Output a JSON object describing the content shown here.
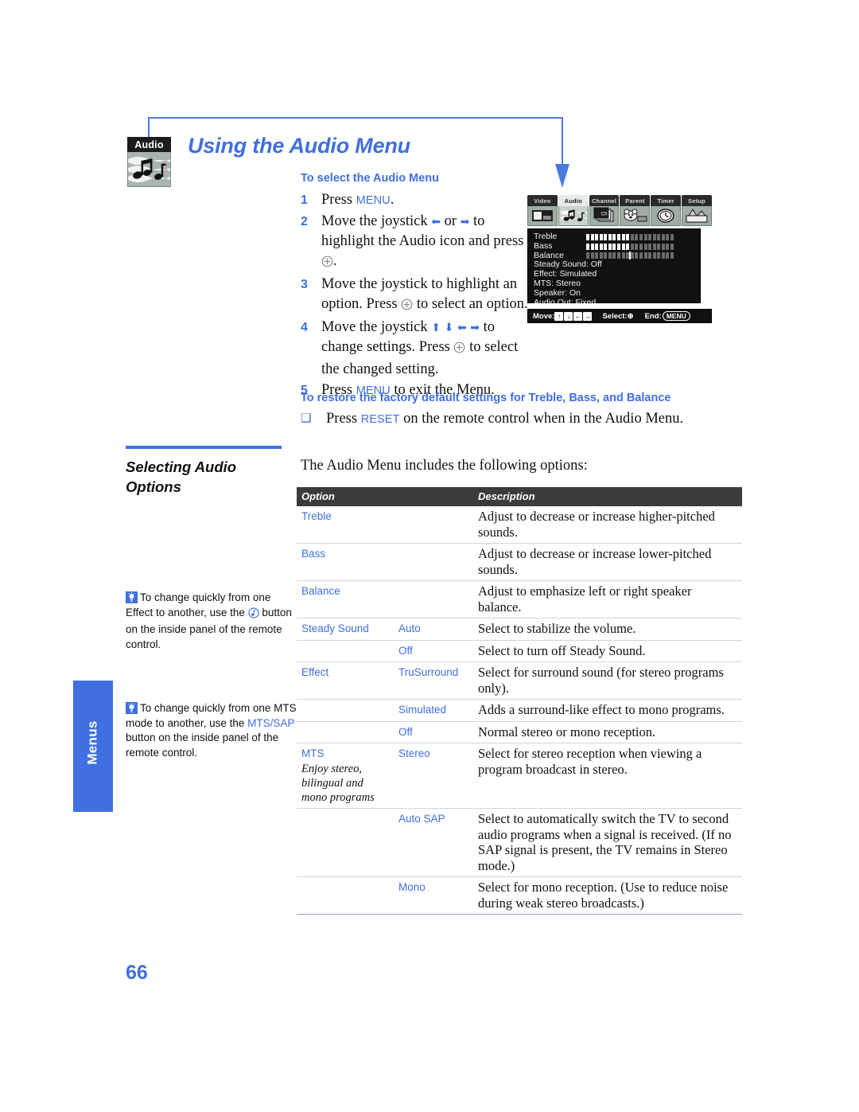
{
  "header": {
    "title": "Using the Audio Menu",
    "icon_label": "Audio",
    "icon_name": "audio-menu-icon"
  },
  "select_section": {
    "heading": "To select the Audio Menu",
    "steps": [
      {
        "num": "1",
        "prefix": "Press ",
        "kw": "MENU",
        "suffix": "."
      },
      {
        "num": "2",
        "prefix": "Move the joystick ",
        "suffix": " to highlight the Audio icon and press "
      },
      {
        "num": "3",
        "prefix": "Move the joystick to highlight an option. Press ",
        "suffix": " to select an option."
      },
      {
        "num": "4",
        "prefix": "Move the joystick ",
        "suffix": " to change settings. Press "
      },
      {
        "num": "5",
        "prefix": "Press ",
        "kw": "MENU",
        "suffix": " to exit the Menu."
      }
    ],
    "step2_tail": ".",
    "step4_tail": " to select the changed setting."
  },
  "tv_menu": {
    "tabs": [
      {
        "label": "Video",
        "icon": "video-icon",
        "selected": false
      },
      {
        "label": "Audio",
        "icon": "audio-notes-icon",
        "selected": true
      },
      {
        "label": "Channel",
        "icon": "channel-icon",
        "selected": false
      },
      {
        "label": "Parent",
        "icon": "parent-bear-icon",
        "selected": false
      },
      {
        "label": "Timer",
        "icon": "clock-icon",
        "selected": false
      },
      {
        "label": "Setup",
        "icon": "setup-icon",
        "selected": false
      }
    ],
    "rows": [
      {
        "name": "Treble",
        "type": "bar",
        "value": 50
      },
      {
        "name": "Bass",
        "type": "bar",
        "value": 50
      },
      {
        "name": "Balance",
        "type": "knob",
        "value": 50
      },
      {
        "name": "Steady Sound: Off",
        "type": "text"
      },
      {
        "name": "Effect: Simulated",
        "type": "text"
      },
      {
        "name": "MTS: Stereo",
        "type": "text"
      },
      {
        "name": "Speaker: On",
        "type": "text"
      },
      {
        "name": "Audio Out: Fixed",
        "type": "text"
      }
    ],
    "footer": {
      "move_label": "Move:",
      "keys": [
        "↑",
        "↓",
        "←",
        "→"
      ],
      "select_label": "Select:",
      "select_symbol": "⊕",
      "end_label": "End:",
      "end_button": "MENU"
    }
  },
  "restore_section": {
    "heading": "To restore the factory default settings for Treble, Bass, and Balance",
    "bullet": "❑",
    "prefix": "Press ",
    "kw": "RESET",
    "suffix": " on the remote control when in the Audio Menu."
  },
  "options_section": {
    "section_title": "Selecting Audio Options",
    "intro": "The Audio Menu includes the following options:",
    "columns": [
      "Option",
      "Description"
    ],
    "rows": [
      {
        "option": "Treble",
        "value": "",
        "desc": "Adjust to decrease or increase higher-pitched sounds."
      },
      {
        "option": "Bass",
        "value": "",
        "desc": "Adjust to decrease or increase lower-pitched sounds."
      },
      {
        "option": "Balance",
        "value": "",
        "desc": "Adjust to emphasize left or right speaker balance."
      },
      {
        "option": "Steady Sound",
        "value": "Auto",
        "desc": "Select to stabilize the volume."
      },
      {
        "option": "",
        "value": "Off",
        "desc": "Select to turn off Steady Sound."
      },
      {
        "option": "Effect",
        "value": "TruSurround",
        "desc": "Select for surround sound (for stereo programs only)."
      },
      {
        "option": "",
        "value": "Simulated",
        "desc": "Adds a surround-like effect to mono programs."
      },
      {
        "option": "",
        "value": "Off",
        "desc": "Normal stereo or mono reception."
      },
      {
        "option": "MTS",
        "option_sub": "Enjoy stereo, bilingual and mono programs",
        "value": "Stereo",
        "desc": "Select for stereo reception when viewing a program broadcast in stereo."
      },
      {
        "option": "",
        "value": "Auto SAP",
        "desc": "Select to automatically switch the TV to second audio programs when a signal is received. (If no SAP signal is present, the TV remains in Stereo mode.)"
      },
      {
        "option": "",
        "value": "Mono",
        "desc": "Select for mono reception. (Use to reduce noise during weak stereo broadcasts.)"
      }
    ]
  },
  "tips": [
    {
      "icon": "tip-lightbulb-icon",
      "text_before": "To change quickly from one Effect to another, use the ",
      "inline_icon": "sound-effect-button-icon",
      "text_after": " button on the inside panel of the remote control."
    },
    {
      "icon": "tip-lightbulb-icon",
      "text_before": "To change quickly from one MTS mode to another, use the ",
      "kw": "MTS/SAP",
      "text_after": " button on the inside panel of the remote control."
    }
  ],
  "side_tab": {
    "label": "Menus"
  },
  "page_number": "66",
  "colors": {
    "accent": "#3f6fe0",
    "table_header": "#3b3b3b"
  }
}
